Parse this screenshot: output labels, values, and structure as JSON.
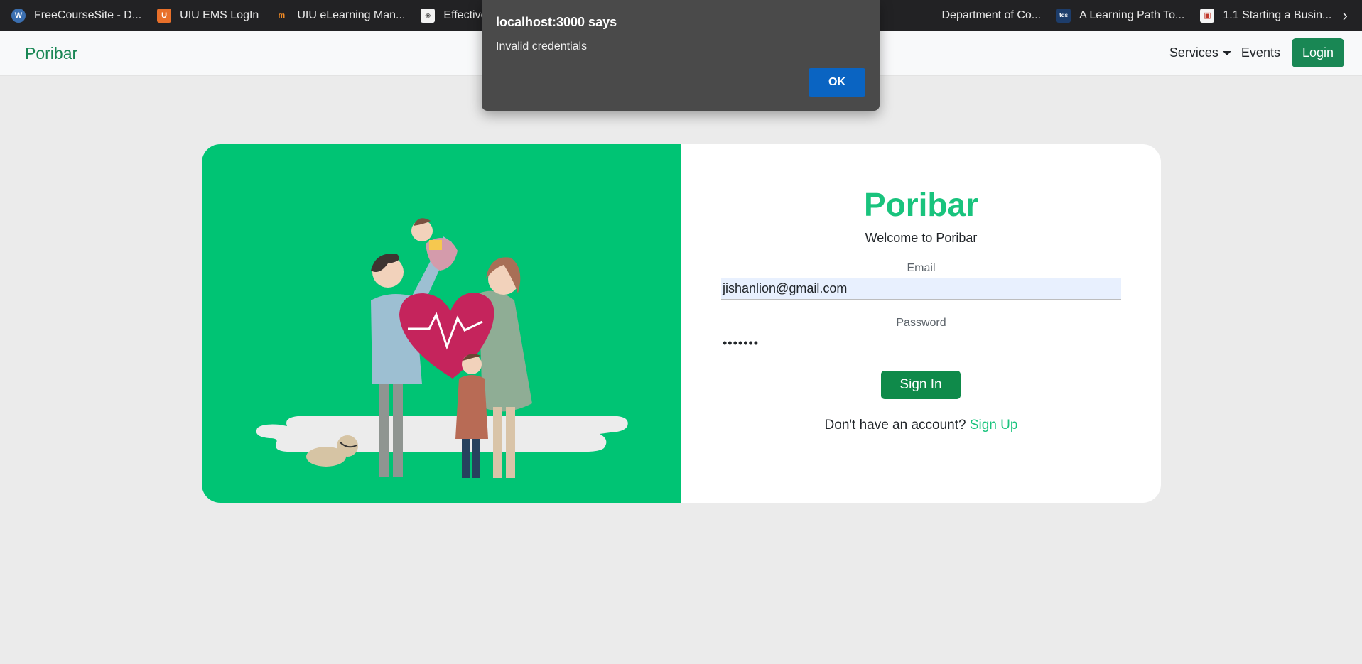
{
  "bookmarks": [
    {
      "label": "FreeCourseSite - D...",
      "icon": "wordpress-icon"
    },
    {
      "label": "UIU EMS LogIn",
      "icon": "uiu-icon"
    },
    {
      "label": "UIU eLearning Man...",
      "icon": "moodle-icon"
    },
    {
      "label": "Effective Resume",
      "icon": "resume-icon"
    },
    {
      "label": "Department of Co...",
      "icon": "department-icon"
    },
    {
      "label": "A Learning Path To...",
      "icon": "tds-icon"
    },
    {
      "label": "1.1 Starting a Busin...",
      "icon": "presentation-icon"
    }
  ],
  "navbar": {
    "brand": "Poribar",
    "services": "Services",
    "events": "Events",
    "login": "Login"
  },
  "card": {
    "title": "Poribar",
    "welcome": "Welcome to Poribar",
    "email_label": "Email",
    "email_value": "jishanlion@gmail.com",
    "password_label": "Password",
    "password_value": "•••••••",
    "signin": "Sign In",
    "signup_prompt": "Don't have an account?",
    "signup_link": "Sign Up"
  },
  "dialog": {
    "title": "localhost:3000 says",
    "message": "Invalid credentials",
    "ok": "OK"
  },
  "colors": {
    "brand_green": "#198754",
    "illustration_bg": "#00c474",
    "title_green": "#19c37d",
    "dialog_ok": "#0a64c2"
  }
}
